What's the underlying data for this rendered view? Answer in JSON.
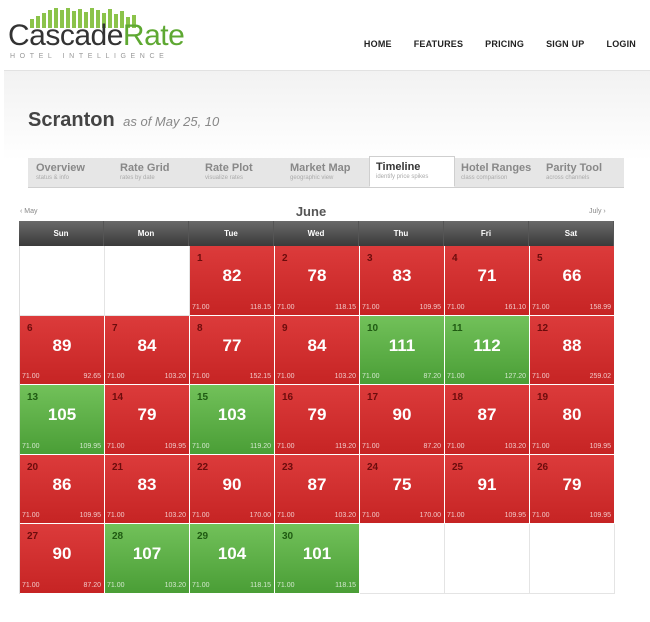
{
  "brand": {
    "name_part1": "Cascade",
    "name_part2": "Rate",
    "tagline": "HOTEL INTELLIGENCE",
    "accent_color": "#5ea832"
  },
  "nav": [
    {
      "label": "HOME"
    },
    {
      "label": "FEATURES"
    },
    {
      "label": "PRICING"
    },
    {
      "label": "SIGN UP"
    },
    {
      "label": "LOGIN"
    }
  ],
  "page": {
    "city": "Scranton",
    "as_of": "as of May 25, 10"
  },
  "tabs": [
    {
      "name": "Overview",
      "sub": "status & info",
      "active": false
    },
    {
      "name": "Rate Grid",
      "sub": "rates by date",
      "active": false
    },
    {
      "name": "Rate Plot",
      "sub": "visualize rates",
      "active": false
    },
    {
      "name": "Market Map",
      "sub": "geographic view",
      "active": false
    },
    {
      "name": "Timeline",
      "sub": "identify price spikes",
      "active": true
    },
    {
      "name": "Hotel Ranges",
      "sub": "class comparison",
      "active": false
    },
    {
      "name": "Parity Tool",
      "sub": "across channels",
      "active": false
    }
  ],
  "calendar": {
    "month": "June",
    "prev_month": "May",
    "next_month": "July",
    "weekdays": [
      "Sun",
      "Mon",
      "Tue",
      "Wed",
      "Thu",
      "Fri",
      "Sat"
    ],
    "leading_blanks": 2,
    "trailing_blanks": 3,
    "colors": {
      "high": "#d32f2f",
      "low": "#5cb046"
    },
    "days": [
      {
        "day": "1",
        "rate": "82",
        "low": "71.00",
        "high": "118.15",
        "status": "red"
      },
      {
        "day": "2",
        "rate": "78",
        "low": "71.00",
        "high": "118.15",
        "status": "red"
      },
      {
        "day": "3",
        "rate": "83",
        "low": "71.00",
        "high": "109.95",
        "status": "red"
      },
      {
        "day": "4",
        "rate": "71",
        "low": "71.00",
        "high": "161.10",
        "status": "red"
      },
      {
        "day": "5",
        "rate": "66",
        "low": "71.00",
        "high": "158.99",
        "status": "red"
      },
      {
        "day": "6",
        "rate": "89",
        "low": "71.00",
        "high": "92.65",
        "status": "red"
      },
      {
        "day": "7",
        "rate": "84",
        "low": "71.00",
        "high": "103.20",
        "status": "red"
      },
      {
        "day": "8",
        "rate": "77",
        "low": "71.00",
        "high": "152.15",
        "status": "red"
      },
      {
        "day": "9",
        "rate": "84",
        "low": "71.00",
        "high": "103.20",
        "status": "red"
      },
      {
        "day": "10",
        "rate": "111",
        "low": "71.00",
        "high": "87.20",
        "status": "green"
      },
      {
        "day": "11",
        "rate": "112",
        "low": "71.00",
        "high": "127.20",
        "status": "green"
      },
      {
        "day": "12",
        "rate": "88",
        "low": "71.00",
        "high": "259.02",
        "status": "red"
      },
      {
        "day": "13",
        "rate": "105",
        "low": "71.00",
        "high": "109.95",
        "status": "green"
      },
      {
        "day": "14",
        "rate": "79",
        "low": "71.00",
        "high": "109.95",
        "status": "red"
      },
      {
        "day": "15",
        "rate": "103",
        "low": "71.00",
        "high": "119.20",
        "status": "green"
      },
      {
        "day": "16",
        "rate": "79",
        "low": "71.00",
        "high": "119.20",
        "status": "red"
      },
      {
        "day": "17",
        "rate": "90",
        "low": "71.00",
        "high": "87.20",
        "status": "red"
      },
      {
        "day": "18",
        "rate": "87",
        "low": "71.00",
        "high": "103.20",
        "status": "red"
      },
      {
        "day": "19",
        "rate": "80",
        "low": "71.00",
        "high": "109.95",
        "status": "red"
      },
      {
        "day": "20",
        "rate": "86",
        "low": "71.00",
        "high": "109.95",
        "status": "red"
      },
      {
        "day": "21",
        "rate": "83",
        "low": "71.00",
        "high": "103.20",
        "status": "red"
      },
      {
        "day": "22",
        "rate": "90",
        "low": "71.00",
        "high": "170.00",
        "status": "red"
      },
      {
        "day": "23",
        "rate": "87",
        "low": "71.00",
        "high": "103.20",
        "status": "red"
      },
      {
        "day": "24",
        "rate": "75",
        "low": "71.00",
        "high": "170.00",
        "status": "red"
      },
      {
        "day": "25",
        "rate": "91",
        "low": "71.00",
        "high": "109.95",
        "status": "red"
      },
      {
        "day": "26",
        "rate": "79",
        "low": "71.00",
        "high": "109.95",
        "status": "red"
      },
      {
        "day": "27",
        "rate": "90",
        "low": "71.00",
        "high": "87.20",
        "status": "red"
      },
      {
        "day": "28",
        "rate": "107",
        "low": "71.00",
        "high": "103.20",
        "status": "green"
      },
      {
        "day": "29",
        "rate": "104",
        "low": "71.00",
        "high": "118.15",
        "status": "green"
      },
      {
        "day": "30",
        "rate": "101",
        "low": "71.00",
        "high": "118.15",
        "status": "green"
      }
    ]
  }
}
